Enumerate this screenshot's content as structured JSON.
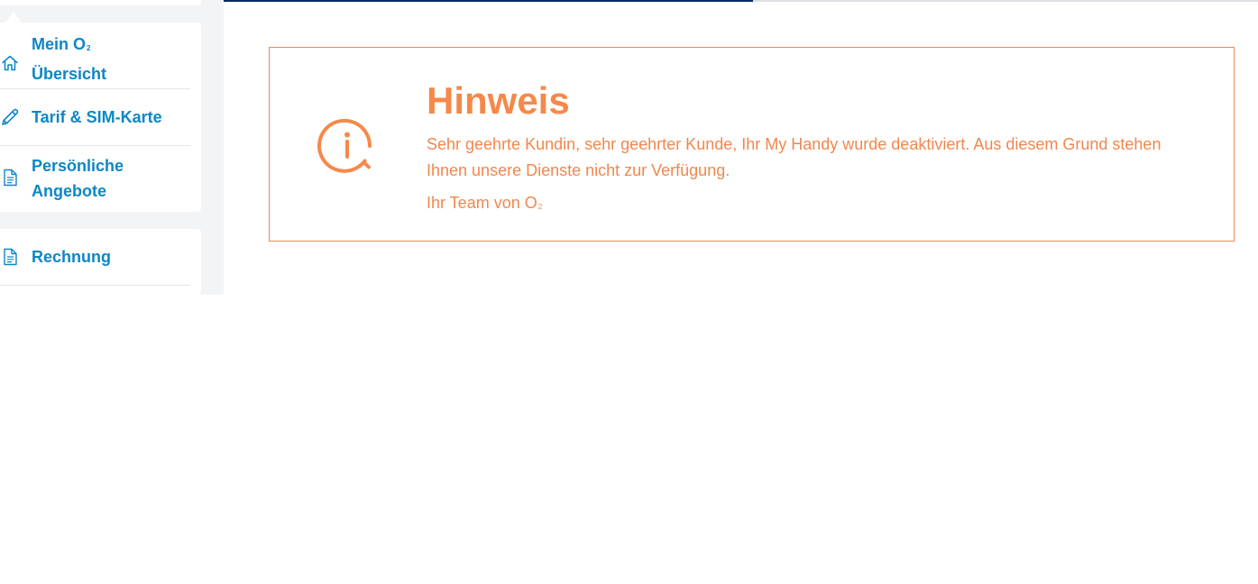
{
  "sidebar": {
    "items": [
      {
        "icon": "home-icon",
        "label_line1": "Mein O",
        "label_sub": "2",
        "label_line2": "Übersicht"
      },
      {
        "icon": "pencil-icon",
        "label": "Tarif & SIM-Karte"
      },
      {
        "icon": "document-icon",
        "label_line1": "Persönliche",
        "label_line2": "Angebote"
      },
      {
        "icon": "document-icon",
        "label": "Rechnung"
      }
    ]
  },
  "progress": {
    "fraction": 0.512
  },
  "notice": {
    "icon": "info-icon",
    "title": "Hinweis",
    "message": "Sehr geehrte Kundin, sehr geehrter Kunde, Ihr My Handy wurde deaktiviert. Aus diesem Grund stehen Ihnen unsere Dienste nicht zur Verfügung.",
    "signature_text": "Ihr Team von O",
    "signature_sub": "2"
  },
  "colors": {
    "nav_text": "#0d86c6",
    "accent_orange": "#f0874d",
    "progress_fill": "#0a2a66"
  }
}
